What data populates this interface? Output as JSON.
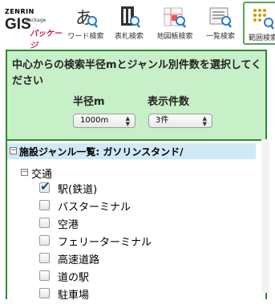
{
  "logo": {
    "brand": "ZENRIN",
    "product": "GIS",
    "small": "package",
    "sub": "パッケージ"
  },
  "toolbar": [
    {
      "label": "ワード検索",
      "icon": "word-search-icon"
    },
    {
      "label": "表札検索",
      "icon": "nameplate-search-icon"
    },
    {
      "label": "地図帳検索",
      "icon": "atlas-search-icon"
    },
    {
      "label": "一覧検索",
      "icon": "list-search-icon"
    },
    {
      "label": "範囲検索",
      "icon": "range-search-icon",
      "active": true
    }
  ],
  "panel": {
    "title": "中心からの検索半径mとジャンル別件数を選択してください",
    "radius_label": "半径m",
    "count_label": "表示件数",
    "radius_value": "1000m",
    "count_value": "3件"
  },
  "tree": {
    "title": "施設ジャンル一覧: ガソリンスタンド/",
    "category": "交通",
    "items": [
      {
        "label": "駅(鉄道)",
        "checked": true
      },
      {
        "label": "バスターミナル",
        "checked": false
      },
      {
        "label": "空港",
        "checked": false
      },
      {
        "label": "フェリーターミナル",
        "checked": false
      },
      {
        "label": "高速道路",
        "checked": false
      },
      {
        "label": "道の駅",
        "checked": false
      },
      {
        "label": "駐車場",
        "checked": false
      }
    ]
  },
  "colors": {
    "panel_bg": "#c8f0c8",
    "panel_border": "#2e8b2e",
    "tree_header_bg": "#cfe9f7",
    "brand_pink": "#c2185b"
  }
}
